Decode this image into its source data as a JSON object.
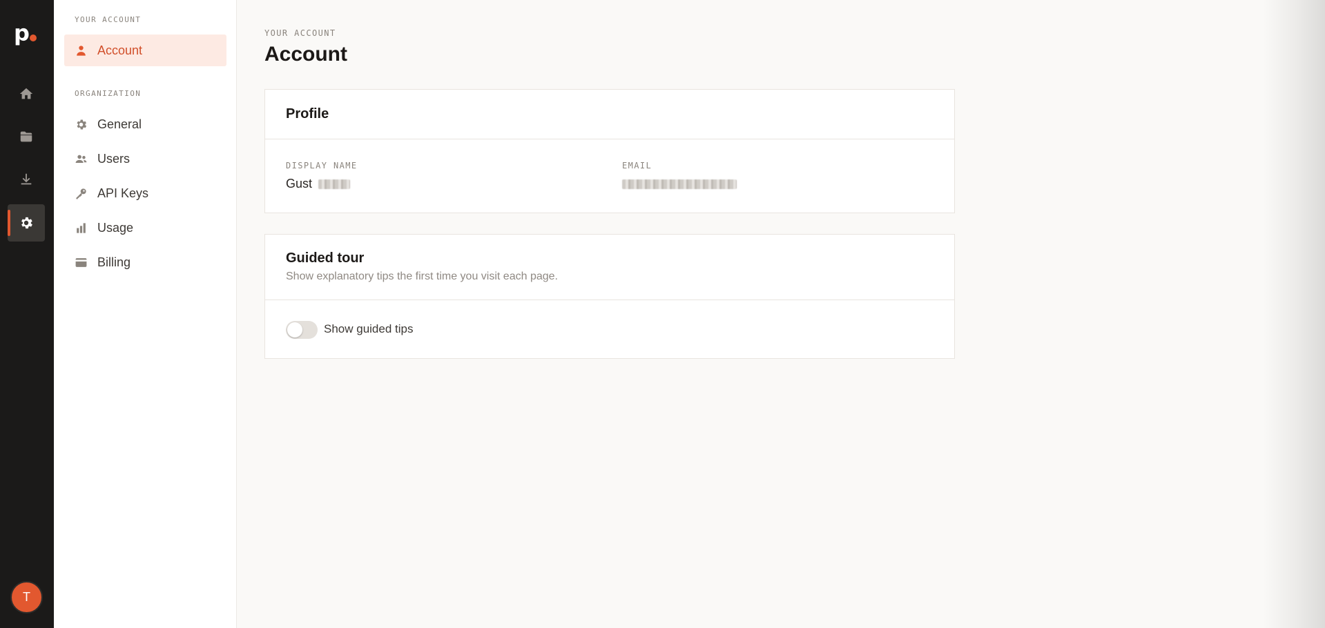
{
  "rail": {
    "logo_letter": "p",
    "active_item": "settings",
    "items": [
      {
        "name": "home",
        "icon": "home-icon"
      },
      {
        "name": "folder",
        "icon": "folder-icon"
      },
      {
        "name": "download",
        "icon": "download-icon"
      },
      {
        "name": "settings",
        "icon": "gear-icon"
      }
    ],
    "avatar_initial": "T"
  },
  "subnav": {
    "account_section_label": "YOUR ACCOUNT",
    "account_items": [
      {
        "label": "Account",
        "icon": "person-icon",
        "active": true
      }
    ],
    "org_section_label": "ORGANIZATION",
    "org_items": [
      {
        "label": "General",
        "icon": "gear-icon"
      },
      {
        "label": "Users",
        "icon": "users-icon"
      },
      {
        "label": "API Keys",
        "icon": "key-icon"
      },
      {
        "label": "Usage",
        "icon": "bar-chart-icon"
      },
      {
        "label": "Billing",
        "icon": "credit-card-icon"
      }
    ]
  },
  "main": {
    "eyebrow": "YOUR ACCOUNT",
    "title": "Account",
    "profile": {
      "title": "Profile",
      "display_name_label": "DISPLAY NAME",
      "display_name_value": "Gust",
      "email_label": "EMAIL"
    },
    "guided_tour": {
      "title": "Guided tour",
      "subtitle": "Show explanatory tips the first time you visit each page.",
      "toggle_label": "Show guided tips",
      "toggle_on": false
    }
  },
  "colors": {
    "accent": "#e2582f",
    "rail_bg": "#1b1a19",
    "page_bg": "#faf9f7"
  }
}
